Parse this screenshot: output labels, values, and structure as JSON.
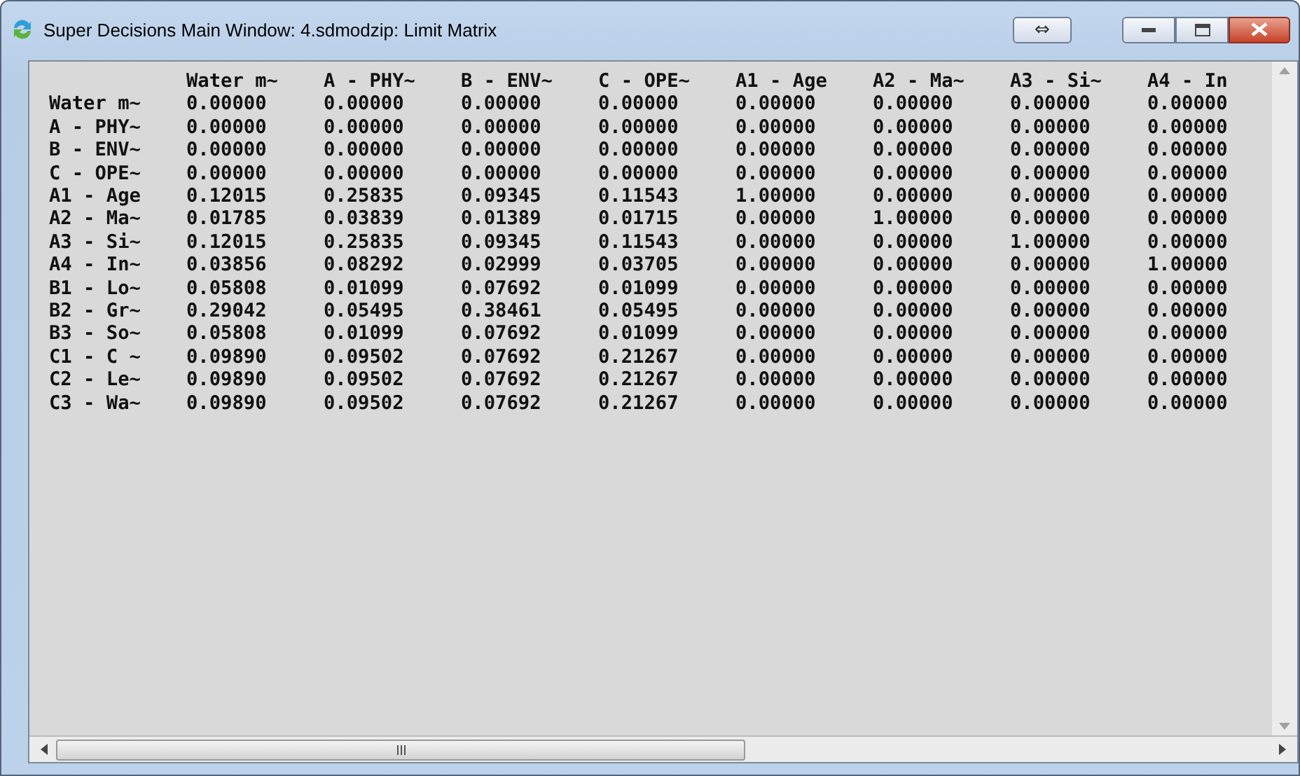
{
  "window": {
    "title": "Super Decisions Main Window: 4.sdmodzip: Limit Matrix",
    "toggle_button": "⇔"
  },
  "matrix": {
    "columns": [
      "Water m~",
      "A - PHY~",
      "B - ENV~",
      "C - OPE~",
      "A1 - Age",
      "A2 - Ma~",
      "A3 - Si~",
      "A4 - In"
    ],
    "rows": [
      {
        "label": "Water m~",
        "values": [
          "0.00000",
          "0.00000",
          "0.00000",
          "0.00000",
          "0.00000",
          "0.00000",
          "0.00000",
          "0.00000"
        ]
      },
      {
        "label": "A - PHY~",
        "values": [
          "0.00000",
          "0.00000",
          "0.00000",
          "0.00000",
          "0.00000",
          "0.00000",
          "0.00000",
          "0.00000"
        ]
      },
      {
        "label": "B - ENV~",
        "values": [
          "0.00000",
          "0.00000",
          "0.00000",
          "0.00000",
          "0.00000",
          "0.00000",
          "0.00000",
          "0.00000"
        ]
      },
      {
        "label": "C - OPE~",
        "values": [
          "0.00000",
          "0.00000",
          "0.00000",
          "0.00000",
          "0.00000",
          "0.00000",
          "0.00000",
          "0.00000"
        ]
      },
      {
        "label": "A1 - Age",
        "values": [
          "0.12015",
          "0.25835",
          "0.09345",
          "0.11543",
          "1.00000",
          "0.00000",
          "0.00000",
          "0.00000"
        ]
      },
      {
        "label": "A2 - Ma~",
        "values": [
          "0.01785",
          "0.03839",
          "0.01389",
          "0.01715",
          "0.00000",
          "1.00000",
          "0.00000",
          "0.00000"
        ]
      },
      {
        "label": "A3 - Si~",
        "values": [
          "0.12015",
          "0.25835",
          "0.09345",
          "0.11543",
          "0.00000",
          "0.00000",
          "1.00000",
          "0.00000"
        ]
      },
      {
        "label": "A4 - In~",
        "values": [
          "0.03856",
          "0.08292",
          "0.02999",
          "0.03705",
          "0.00000",
          "0.00000",
          "0.00000",
          "1.00000"
        ]
      },
      {
        "label": "B1 - Lo~",
        "values": [
          "0.05808",
          "0.01099",
          "0.07692",
          "0.01099",
          "0.00000",
          "0.00000",
          "0.00000",
          "0.00000"
        ]
      },
      {
        "label": "B2 - Gr~",
        "values": [
          "0.29042",
          "0.05495",
          "0.38461",
          "0.05495",
          "0.00000",
          "0.00000",
          "0.00000",
          "0.00000"
        ]
      },
      {
        "label": "B3 - So~",
        "values": [
          "0.05808",
          "0.01099",
          "0.07692",
          "0.01099",
          "0.00000",
          "0.00000",
          "0.00000",
          "0.00000"
        ]
      },
      {
        "label": "C1 - C ~",
        "values": [
          "0.09890",
          "0.09502",
          "0.07692",
          "0.21267",
          "0.00000",
          "0.00000",
          "0.00000",
          "0.00000"
        ]
      },
      {
        "label": "C2 - Le~",
        "values": [
          "0.09890",
          "0.09502",
          "0.07692",
          "0.21267",
          "0.00000",
          "0.00000",
          "0.00000",
          "0.00000"
        ]
      },
      {
        "label": "C3 - Wa~",
        "values": [
          "0.09890",
          "0.09502",
          "0.07692",
          "0.21267",
          "0.00000",
          "0.00000",
          "0.00000",
          "0.00000"
        ]
      }
    ]
  }
}
